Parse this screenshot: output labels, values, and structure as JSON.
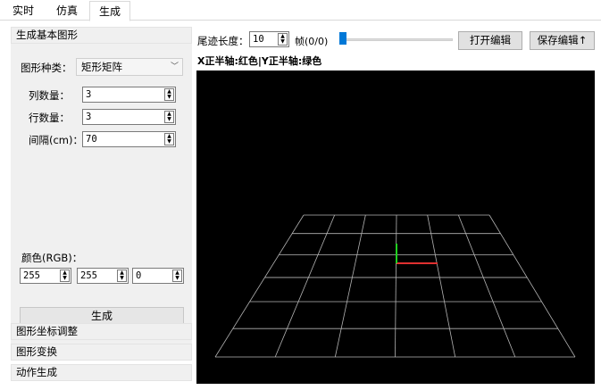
{
  "tabs": [
    "实时",
    "仿真",
    "生成"
  ],
  "sections": {
    "generate_basic": "生成基本图形",
    "coord_adjust": "图形坐标调整",
    "transform": "图形变换",
    "action_gen": "动作生成"
  },
  "shape": {
    "label": "图形种类：",
    "value": "矩形矩阵"
  },
  "fields": {
    "cols_label": "列数量：",
    "cols": "3",
    "rows_label": "行数量：",
    "rows": "3",
    "spacing_label": "间隔(cm)：",
    "spacing": "70"
  },
  "color": {
    "label": "颜色(RGB)：",
    "r": "255",
    "g": "255",
    "b": "0"
  },
  "generate_button": "生成",
  "trail": {
    "label": "尾迹长度：",
    "value": "10"
  },
  "frame": {
    "label": "帧(0/0)",
    "progress": 0
  },
  "buttons": {
    "open_edit": "打开编辑",
    "save_edit": "保存编辑↑"
  },
  "axis_caption": "X正半轴:红色|Y正半轴:绿色",
  "viewport": {
    "background": "#000000",
    "grid_color": "#b4b4b4",
    "x_axis_color": "#e03030",
    "y_axis_color": "#20d020",
    "grid_cells": 6
  }
}
